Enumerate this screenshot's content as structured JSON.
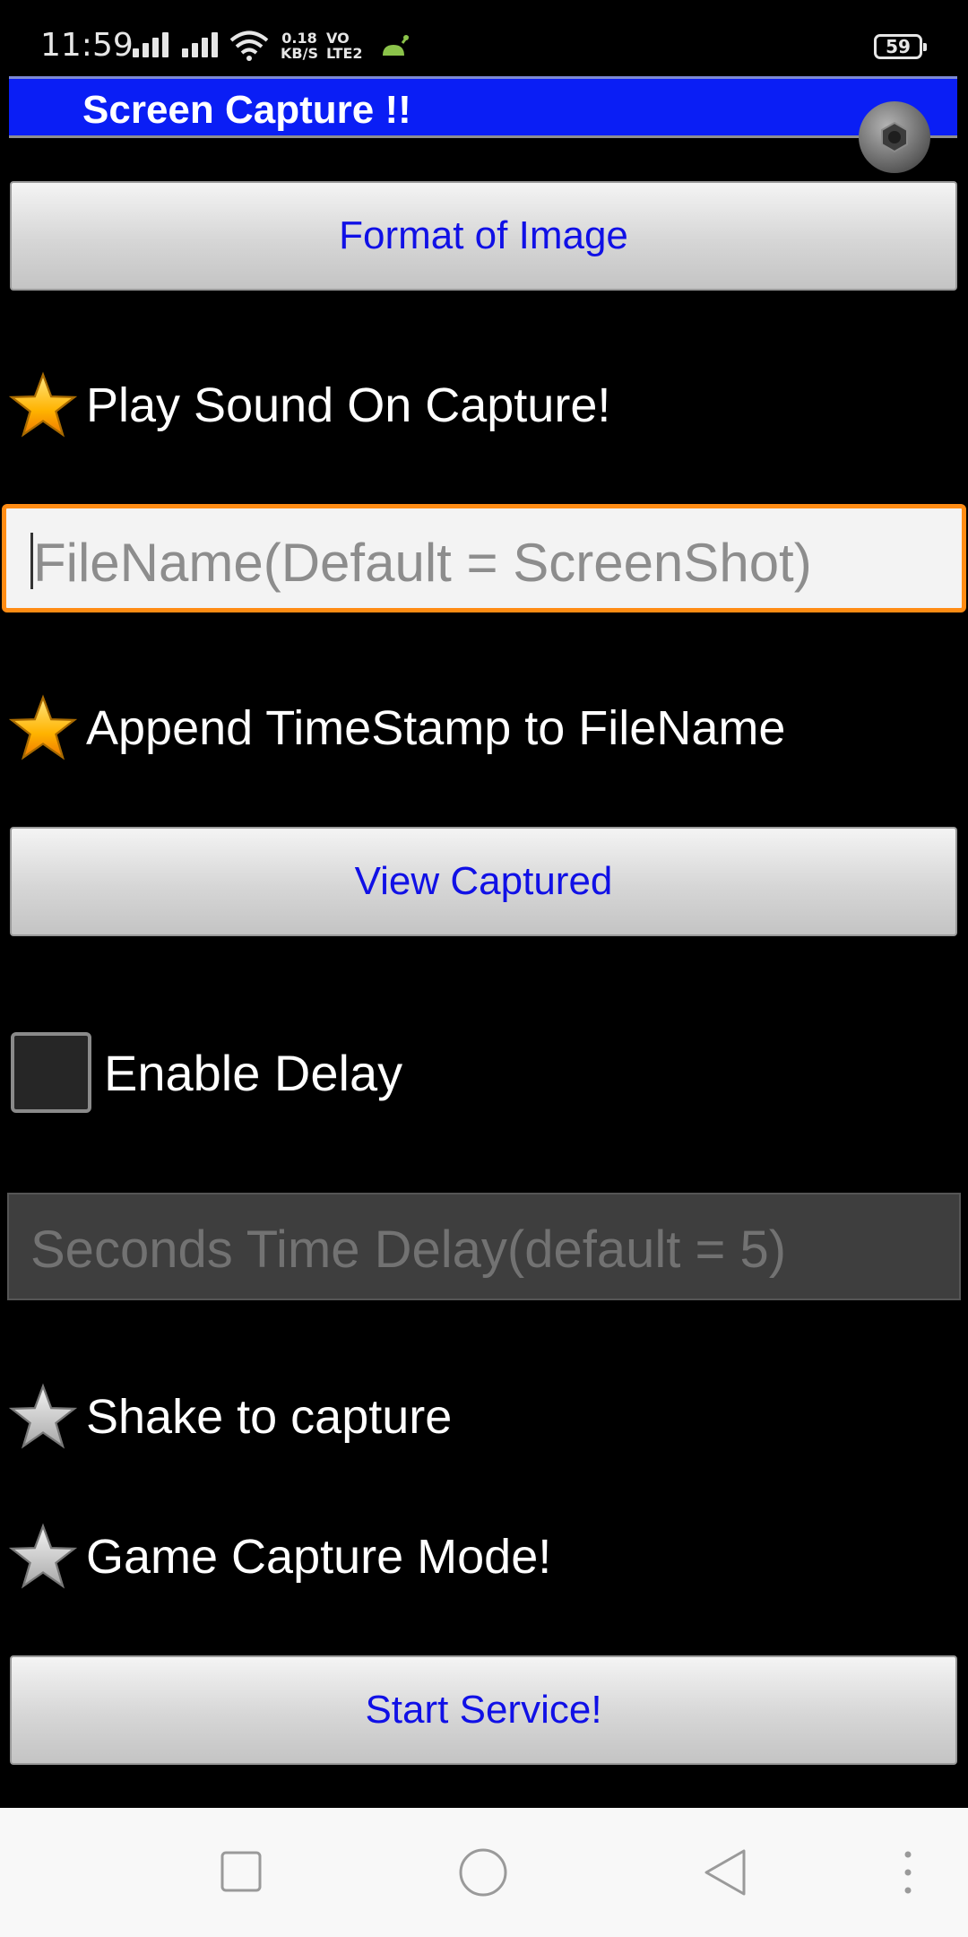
{
  "status_bar": {
    "time": "11:59",
    "net_speed_value": "0.18",
    "net_speed_unit": "KB/S",
    "volte_top": "VO",
    "volte_bottom": "LTE2",
    "battery": "59"
  },
  "app": {
    "title": "Screen Capture !!"
  },
  "main": {
    "format_button": "Format of Image",
    "play_sound_label": "Play Sound On Capture!",
    "filename_placeholder": "FileName(Default = ScreenShot)",
    "append_timestamp_label": "Append TimeStamp to FileName",
    "view_captured_button": "View Captured",
    "enable_delay_label": "Enable Delay",
    "delay_placeholder": "Seconds Time Delay(default = 5)",
    "shake_label": "Shake to capture",
    "game_mode_label": "Game Capture Mode!",
    "start_service_button": "Start Service!"
  },
  "states": {
    "play_sound": "checked",
    "append_timestamp": "checked",
    "enable_delay": "unchecked",
    "shake_to_capture": "unchecked",
    "game_capture_mode": "unchecked"
  },
  "colors": {
    "title_bar": "#0a1ef5",
    "button_text": "#1010e6",
    "focus_border": "#ff8c14",
    "star_on": "#ffb300",
    "star_off": "#c8c8c8"
  },
  "icons": {
    "status": [
      "signal-icon",
      "signal-icon",
      "wifi-icon",
      "android-icon",
      "battery-icon"
    ],
    "app": "camera-shutter-icon",
    "nav": [
      "recent-apps-icon",
      "home-icon",
      "back-icon",
      "more-icon"
    ]
  }
}
